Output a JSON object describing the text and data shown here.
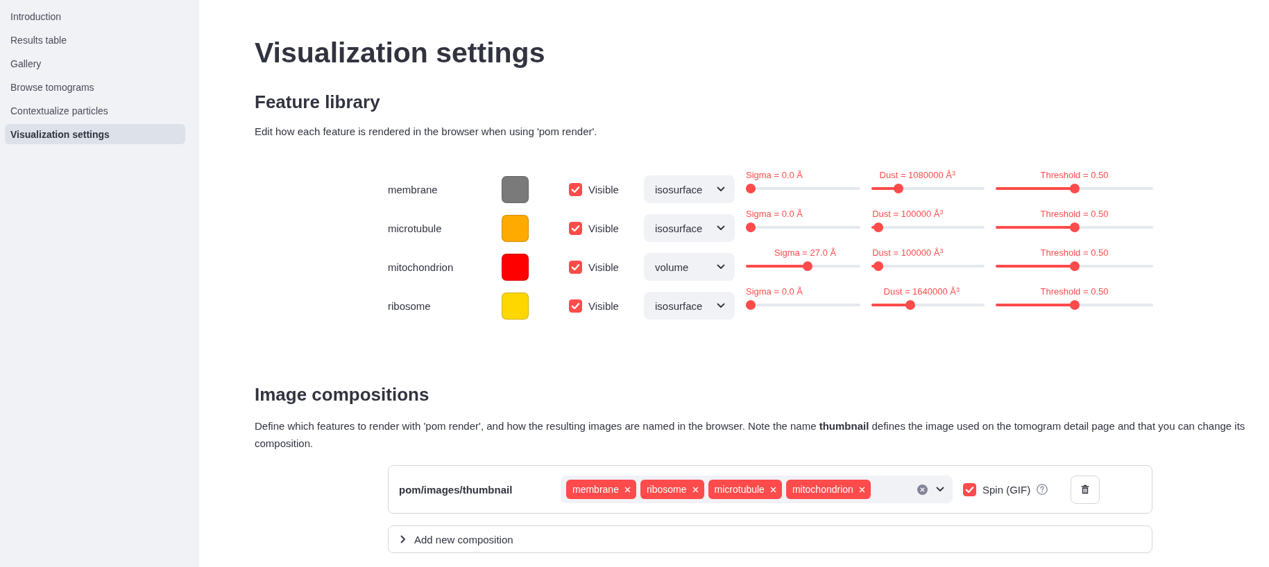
{
  "sidebar": {
    "items": [
      {
        "label": "Introduction",
        "selected": false
      },
      {
        "label": "Results table",
        "selected": false
      },
      {
        "label": "Gallery",
        "selected": false
      },
      {
        "label": "Browse tomograms",
        "selected": false
      },
      {
        "label": "Contextualize particles",
        "selected": false
      },
      {
        "label": "Visualization settings",
        "selected": true
      }
    ]
  },
  "page": {
    "title": "Visualization settings"
  },
  "feature_library": {
    "heading": "Feature library",
    "description": "Edit how each feature is rendered in the browser when using 'pom render'.",
    "features": [
      {
        "name": "membrane",
        "color": "#7a7a7a",
        "visible": true,
        "visible_label": "Visible",
        "render_mode": "isosurface",
        "sliders": [
          {
            "label": "Sigma = 0.0 Å",
            "level": 0
          },
          {
            "label": "Dust = 1080000 Å$^{3}$",
            "level": 0.216
          },
          {
            "label": "Threshold = 0.50",
            "level": 0.5
          }
        ]
      },
      {
        "name": "microtubule",
        "color": "#ffaa00",
        "visible": true,
        "visible_label": "Visible",
        "render_mode": "isosurface",
        "sliders": [
          {
            "label": "Sigma = 0.0 Å",
            "level": 0
          },
          {
            "label": "Dust = 100000 Å$^{3}$",
            "level": 0.02
          },
          {
            "label": "Threshold = 0.50",
            "level": 0.5
          }
        ]
      },
      {
        "name": "mitochondrion",
        "color": "#ff0000",
        "visible": true,
        "visible_label": "Visible",
        "render_mode": "volume",
        "sliders": [
          {
            "label": "Sigma = 27.0 Å",
            "level": 0.54
          },
          {
            "label": "Dust = 100000 Å$^{3}$",
            "level": 0.02
          },
          {
            "label": "Threshold = 0.50",
            "level": 0.5
          }
        ]
      },
      {
        "name": "ribosome",
        "color": "#ffd700",
        "visible": true,
        "visible_label": "Visible",
        "render_mode": "isosurface",
        "sliders": [
          {
            "label": "Sigma = 0.0 Å",
            "level": 0
          },
          {
            "label": "Dust = 1640000 Å$^{3}$",
            "level": 0.328
          },
          {
            "label": "Threshold = 0.50",
            "level": 0.5
          }
        ]
      }
    ]
  },
  "image_compositions": {
    "heading": "Image compositions",
    "description": "Define which features to render with 'pom render', and how the resulting images are named in the browser. Note the name **thumbnail** defines the image used on the tomogram detail page and that you can change its composition.",
    "compositions": [
      {
        "name": "pom/images/thumbnail",
        "features": [
          "membrane",
          "ribosome",
          "microtubule",
          "mitochondrion"
        ],
        "spin": {
          "label": "Spin (GIF)",
          "checked": true
        }
      }
    ],
    "add_label": "Add new composition"
  }
}
